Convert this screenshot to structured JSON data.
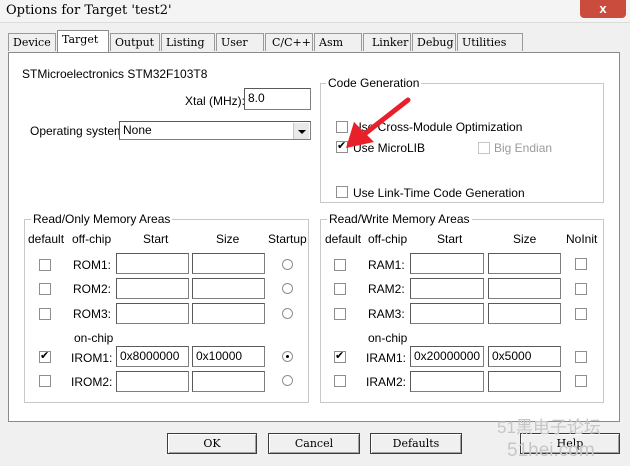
{
  "window": {
    "title": "Options for Target 'test2'",
    "close_glyph": "x"
  },
  "tabs": [
    {
      "label": "Device"
    },
    {
      "label": "Target"
    },
    {
      "label": "Output"
    },
    {
      "label": "Listing"
    },
    {
      "label": "User"
    },
    {
      "label": "C/C++"
    },
    {
      "label": "Asm"
    },
    {
      "label": "Linker"
    },
    {
      "label": "Debug"
    },
    {
      "label": "Utilities"
    }
  ],
  "device": {
    "name": "STMicroelectronics STM32F103T8"
  },
  "xtal": {
    "label": "Xtal (MHz):",
    "value": "8.0"
  },
  "os": {
    "label": "Operating system:",
    "value": "None"
  },
  "code_generation": {
    "title": "Code Generation",
    "cross_module": "Use Cross-Module Optimization",
    "microlib": "Use MicroLIB",
    "big_endian": "Big Endian",
    "link_time": "Use Link-Time Code Generation"
  },
  "ro_memory": {
    "title": "Read/Only Memory Areas",
    "headers": {
      "default": "default",
      "offchip": "off-chip",
      "start": "Start",
      "size": "Size",
      "startup": "Startup"
    },
    "onchip_label": "on-chip",
    "rows": [
      {
        "label": "ROM1:",
        "start": "",
        "size": ""
      },
      {
        "label": "ROM2:",
        "start": "",
        "size": ""
      },
      {
        "label": "ROM3:",
        "start": "",
        "size": ""
      },
      {
        "label": "IROM1:",
        "start": "0x8000000",
        "size": "0x10000"
      },
      {
        "label": "IROM2:",
        "start": "",
        "size": ""
      }
    ]
  },
  "rw_memory": {
    "title": "Read/Write Memory Areas",
    "headers": {
      "default": "default",
      "offchip": "off-chip",
      "start": "Start",
      "size": "Size",
      "noinit": "NoInit"
    },
    "onchip_label": "on-chip",
    "rows": [
      {
        "label": "RAM1:",
        "start": "",
        "size": ""
      },
      {
        "label": "RAM2:",
        "start": "",
        "size": ""
      },
      {
        "label": "RAM3:",
        "start": "",
        "size": ""
      },
      {
        "label": "IRAM1:",
        "start": "0x20000000",
        "size": "0x5000"
      },
      {
        "label": "IRAM2:",
        "start": "",
        "size": ""
      }
    ]
  },
  "buttons": {
    "ok": "OK",
    "cancel": "Cancel",
    "defaults": "Defaults",
    "help": "Help"
  },
  "watermark": {
    "line1": "51黑电子论坛",
    "line2": "51hei.com"
  },
  "colors": {
    "annotation_arrow": "#e8202a",
    "close_button": "#c94c3c"
  }
}
